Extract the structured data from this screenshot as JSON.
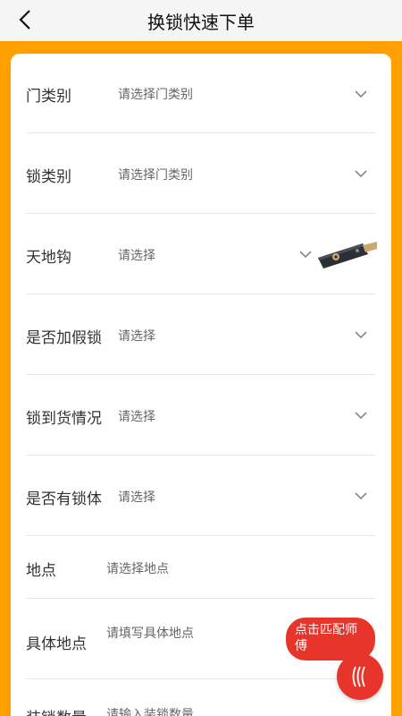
{
  "header": {
    "title": "换锁快速下单"
  },
  "form": {
    "door_type": {
      "label": "门类别",
      "placeholder": "请选择门类别"
    },
    "lock_type": {
      "label": "锁类别",
      "placeholder": "请选择门类别"
    },
    "sky_earth_hook": {
      "label": "天地钩",
      "placeholder": "请选择"
    },
    "fake_lock": {
      "label": "是否加假锁",
      "placeholder": "请选择"
    },
    "lock_arrival": {
      "label": "锁到货情况",
      "placeholder": "请选择"
    },
    "has_lock_body": {
      "label": "是否有锁体",
      "placeholder": "请选择"
    },
    "location": {
      "label": "地点",
      "placeholder": "请选择地点"
    },
    "detail_location": {
      "label": "具体地点",
      "placeholder": "请填写具体地点"
    },
    "install_count": {
      "label": "装锁数量",
      "placeholder": "请输入装锁数量"
    }
  },
  "match_button": {
    "label": "点击匹配师傅"
  },
  "icons": {
    "back": "chevron-left-icon",
    "dropdown": "chevron-down-icon",
    "fab": "wave-lines-icon"
  },
  "colors": {
    "accent": "#FFA000",
    "action": "#E8352B"
  }
}
